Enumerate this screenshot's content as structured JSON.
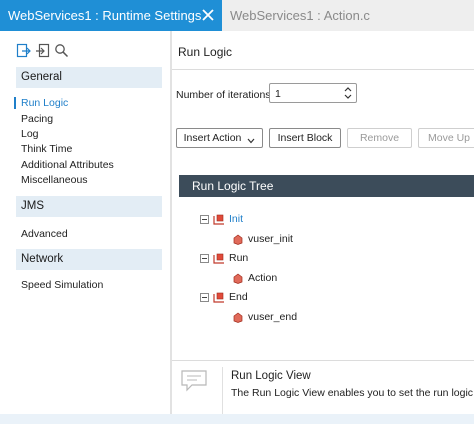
{
  "tabs": [
    {
      "label": "WebServices1 : Runtime Settings",
      "active": true
    },
    {
      "label": "WebServices1 : Action.c",
      "active": false
    }
  ],
  "toolbar_icons": [
    "export-icon",
    "import-icon",
    "search-icon"
  ],
  "nav": {
    "groups": [
      {
        "header": "General",
        "items": [
          "Run Logic",
          "Pacing",
          "Log",
          "Think Time",
          "Additional Attributes",
          "Miscellaneous"
        ]
      },
      {
        "header": "JMS",
        "items": [
          "Advanced"
        ]
      },
      {
        "header": "Network",
        "items": [
          "Speed Simulation"
        ]
      }
    ],
    "selected": "Run Logic"
  },
  "main": {
    "title": "Run Logic",
    "iterations_label": "Number of iterations",
    "iterations_value": "1",
    "buttons": {
      "insert_action": "Insert Action",
      "insert_block": "Insert Block",
      "remove": "Remove",
      "move_up": "Move Up"
    },
    "tree": {
      "header": "Run Logic Tree",
      "nodes": [
        {
          "label": "Init",
          "children": [
            "vuser_init"
          ]
        },
        {
          "label": "Run",
          "children": [
            "Action"
          ]
        },
        {
          "label": "End",
          "children": [
            "vuser_end"
          ]
        }
      ]
    },
    "info": {
      "title": "Run Logic View",
      "description": "The Run Logic View enables you to set the run logic run"
    }
  },
  "colors": {
    "accent": "#1f8fd6",
    "selected_text": "#1f7fc9",
    "tree_header_bg": "#3c4c5a",
    "group_header_bg": "#e3edf5"
  }
}
